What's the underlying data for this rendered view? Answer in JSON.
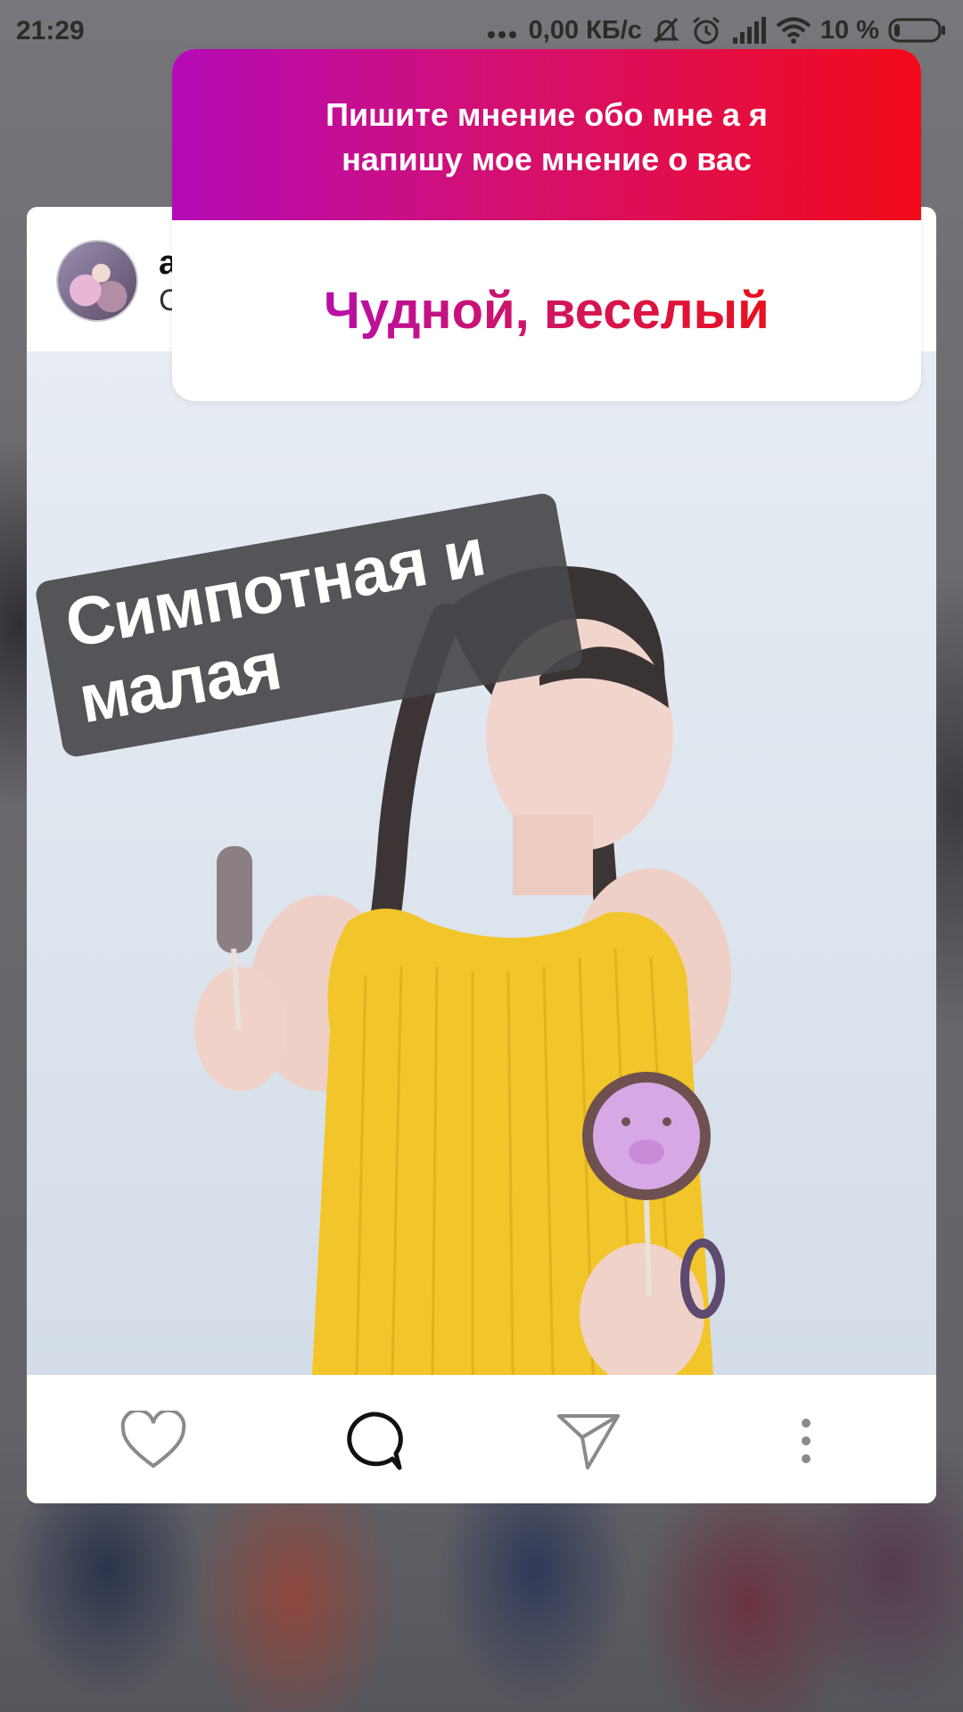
{
  "status_bar": {
    "time": "21:29",
    "network_speed": "0,00 КБ/с",
    "battery_percent": "10 %",
    "icons": [
      "dots-icon",
      "bell-off-icon",
      "alarm-icon",
      "signal-icon",
      "wifi-icon",
      "battery-icon"
    ]
  },
  "post": {
    "username": "a",
    "subtitle": "C",
    "caption_sticker": "Симпотная и малая"
  },
  "question_sticker": {
    "question": "Пишите мнение обо мне а я напишу мое мнение о вас",
    "answer": "Чудной, веселый",
    "gradient_colors": [
      "#b40bb7",
      "#d41070",
      "#f20b18"
    ]
  },
  "actions": [
    {
      "icon": "heart-icon"
    },
    {
      "icon": "comment-icon"
    },
    {
      "icon": "send-icon"
    },
    {
      "icon": "more-icon"
    }
  ]
}
